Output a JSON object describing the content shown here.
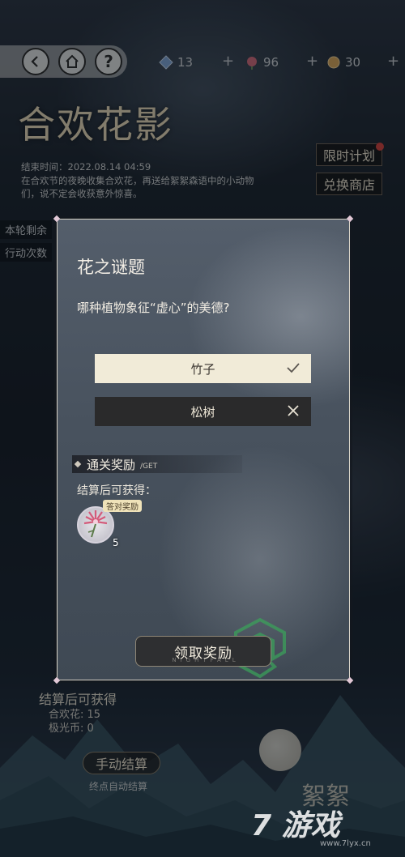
{
  "topbar": {
    "resources": [
      {
        "name": "star-crystal",
        "value": "13",
        "color": "#7ea4d6"
      },
      {
        "name": "hehua-flower",
        "value": "96",
        "color": "#d26a7a"
      },
      {
        "name": "aurora-coin",
        "value": "30",
        "color": "#d9a75a"
      }
    ],
    "plus": "+"
  },
  "event": {
    "title": "合欢花影",
    "end_time": "结束时间：2022.08.14 04:59",
    "description": "在合欢节的夜晚收集合欢花，再送给絮絮森语中的小动物们，说不定会收获意外惊喜。"
  },
  "side_tabs": {
    "limited_plan": "限时计划",
    "exchange_shop": "兑换商店"
  },
  "background_peek": {
    "round_remaining": "本轮剩余",
    "action_count": "行动次数",
    "settle_header": "结算后可获得",
    "hehua_label": "合欢花:",
    "hehua_value": "15",
    "aurora_label": "极光币:",
    "aurora_value": "0",
    "manual_settle": "手动结算",
    "auto_settle_note": "终点自动结算",
    "corner_text": "絮絮"
  },
  "dialog": {
    "title": "花之谜题",
    "question": "哪种植物象征“虚心”的美德?",
    "options": [
      {
        "label": "竹子",
        "state": "correct"
      },
      {
        "label": "松树",
        "state": "wrong"
      }
    ],
    "reward_header": "通关奖励",
    "reward_header_sub": "/GET",
    "reward_sub": "结算后可获得：",
    "reward_item": {
      "tag": "答对奖励",
      "count": "5"
    },
    "claim_button": "领取奖励",
    "claim_sub": "NIGHTFALL"
  },
  "watermark": {
    "logo": "7 游戏",
    "url": "www.7lyx.cn"
  }
}
